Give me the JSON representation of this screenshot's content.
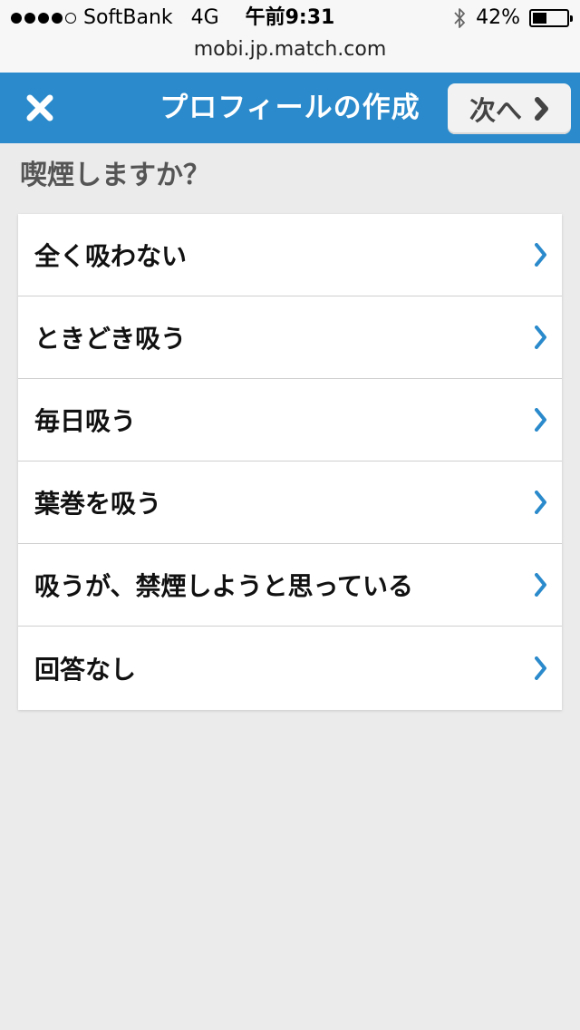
{
  "status_bar": {
    "carrier": "SoftBank",
    "network": "4G",
    "time": "午前9:31",
    "battery_text": "42%",
    "battery_level": 0.42,
    "signal_bars_filled": 4,
    "signal_bars_total": 5
  },
  "browser": {
    "url": "mobi.jp.match.com"
  },
  "header": {
    "title": "プロフィールの作成",
    "next_label": "次へ",
    "close_icon": "close-icon",
    "accent_color": "#2a8acb"
  },
  "question": {
    "text": "喫煙しますか？"
  },
  "options": [
    {
      "label": "全く吸わない"
    },
    {
      "label": "ときどき吸う"
    },
    {
      "label": "毎日吸う"
    },
    {
      "label": "葉巻を吸う"
    },
    {
      "label": "吸うが、禁煙しようと思っている"
    },
    {
      "label": "回答なし"
    }
  ]
}
